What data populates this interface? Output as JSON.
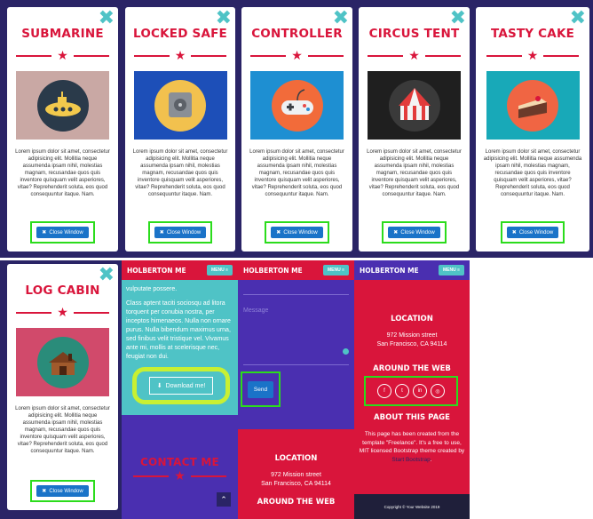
{
  "lorem": "Lorem ipsum dolor sit amet, consectetur adipisicing elit. Mollitia neque assumenda ipsam nihil, molestias magnam, recusandae quos quis inventore quisquam velit asperiores, vitae? Reprehenderit soluta, eos quod consequuntur itaque. Nam.",
  "close_window_label": "Close Window",
  "close_icon_glyph": "✖",
  "modals": [
    {
      "title": "SUBMARINE",
      "image_bg": "#c9a8a4",
      "icon": "submarine-icon"
    },
    {
      "title": "LOCKED SAFE",
      "image_bg": "#1d4fb8",
      "icon": "safe-icon"
    },
    {
      "title": "CONTROLLER",
      "image_bg": "#1e8fd2",
      "icon": "controller-icon"
    },
    {
      "title": "CIRCUS TENT",
      "image_bg": "#1f1f1f",
      "icon": "tent-icon"
    },
    {
      "title": "TASTY CAKE",
      "image_bg": "#18a9b8",
      "icon": "cake-icon"
    },
    {
      "title": "LOG CABIN",
      "image_bg": "#d14a6b",
      "icon": "cabin-icon"
    }
  ],
  "navbar": {
    "brand": "HOLBERTON ME",
    "menu_label": "MENU"
  },
  "about_panel": {
    "text1": "vulputate possere.",
    "text2": "Class aptent taciti sociosqu ad litora torquent per conubia nostra, per inceptos himenaeos. Nulla non ornare purus. Nulla bibendum maximus urna, sed finibus velit tristique vel. Vivamus ante mi, mollis at scelerisque nec, feugiat non dui.",
    "download_label": "Download me!",
    "contact_title": "CONTACT ME"
  },
  "contact_panel": {
    "message_placeholder": "Message",
    "send_label": "Send",
    "location_title": "LOCATION",
    "address_line1": "972 Mission street",
    "address_line2": "San Francisco, CA 94114",
    "around_title": "AROUND THE WEB"
  },
  "footer_panel": {
    "location_title": "LOCATION",
    "address_line1": "972 Mission street",
    "address_line2": "San Francisco, CA 94114",
    "around_title": "AROUND THE WEB",
    "social": [
      "f",
      "t",
      "in",
      "◎"
    ],
    "about_title": "ABOUT THIS PAGE",
    "about_text_before": "This page has been created from the template \"Freelance\". It's a free to use, MIT licensed Bootstrap theme created by ",
    "about_link": "Start Bootstrap",
    "about_text_after": ".",
    "copyright": "Copyright © Your Website 2019"
  },
  "colors": {
    "red": "#d9153b",
    "teal": "#4fc3c6",
    "blue": "#1a73c8",
    "purple": "#4a2fb0",
    "highlight_green": "#2bdc1c"
  }
}
